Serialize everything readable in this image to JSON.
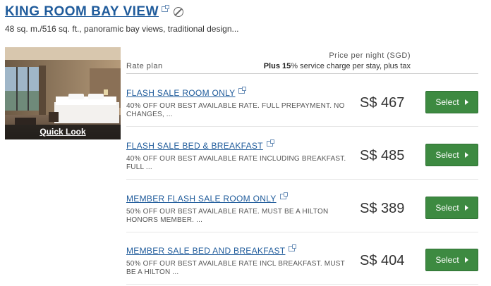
{
  "room": {
    "title": "KING ROOM BAY VIEW",
    "description": "48 sq. m./516 sq. ft., panoramic bay views, traditional design...",
    "quick_look_label": "Quick Look",
    "photo_icon": "room-photo"
  },
  "table_header": {
    "rate_plan": "Rate plan",
    "price_per_night": "Price per night (SGD)",
    "charge_bold": "Plus 15",
    "charge_rest": "% service charge per stay, plus tax"
  },
  "rates": [
    {
      "name": "FLASH SALE ROOM ONLY",
      "description": "40% OFF OUR BEST AVAILABLE RATE. FULL PREPAYMENT. NO CHANGES, ...",
      "price": "S$ 467",
      "button": "Select"
    },
    {
      "name": "FLASH SALE BED & BREAKFAST",
      "description": "40% OFF OUR BEST AVAILABLE RATE INCLUDING BREAKFAST. FULL ...",
      "price": "S$ 485",
      "button": "Select"
    },
    {
      "name": "MEMBER FLASH SALE ROOM ONLY",
      "description": "50% OFF OUR BEST AVAILABLE RATE. MUST BE A HILTON HONORS MEMBER. ...",
      "price": "S$ 389",
      "button": "Select"
    },
    {
      "name": "MEMBER SALE BED AND BREAKFAST",
      "description": "50% OFF OUR BEST AVAILABLE RATE INCL BREAKFAST. MUST BE A HILTON ...",
      "price": "S$ 404",
      "button": "Select"
    }
  ],
  "colors": {
    "link": "#1f5b9b",
    "select_button": "#3d8a41"
  }
}
